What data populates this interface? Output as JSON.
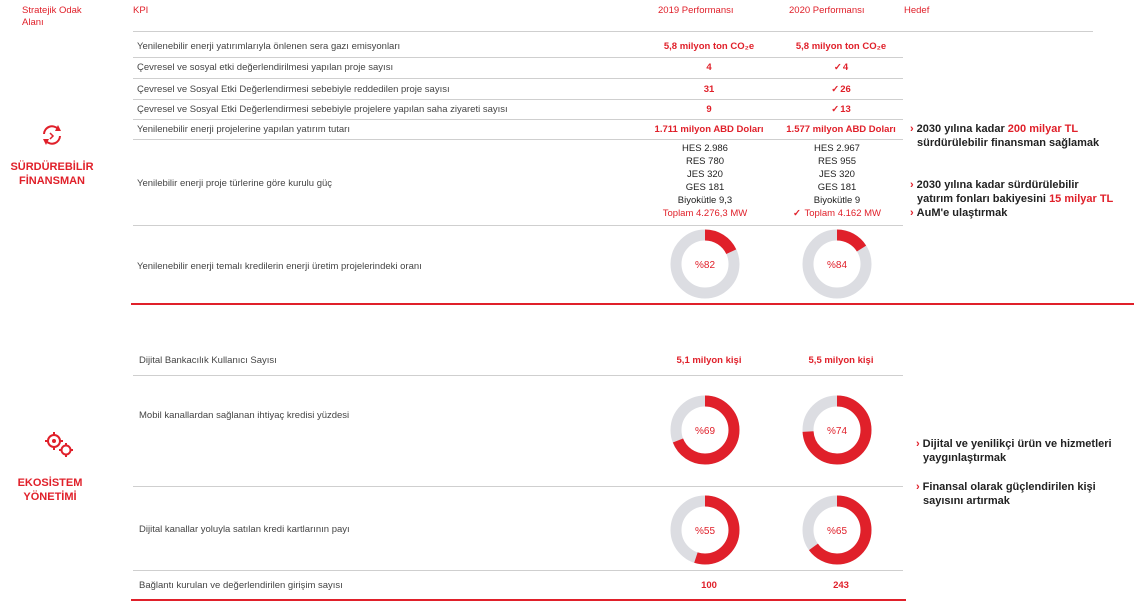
{
  "header": {
    "focus_area": "Stratejik Odak\nAlanı",
    "kpi": "KPI",
    "perf_2019": "2019 Performansı",
    "perf_2020": "2020 Performansı",
    "target": "Hedef"
  },
  "colors": {
    "accent": "#e0202a",
    "track": "#dcdde2"
  },
  "section1": {
    "title_line1": "SÜRDÜREBİLİR",
    "title_line2": "FİNANSMAN",
    "icon": "recycle-arrows-icon",
    "rows": [
      {
        "kpi": "Yenilenebilir enerji yatırımlarıyla önlenen sera gazı emisyonları",
        "v2019": "5,8 milyon ton CO₂e",
        "v2020": "5,8 milyon ton CO₂e"
      },
      {
        "kpi": "Çevresel ve sosyal etki değerlendirilmesi yapılan proje sayısı",
        "v2019": "4",
        "v2020": "4"
      },
      {
        "kpi": "Çevresel ve Sosyal Etki Değerlendirmesi sebebiyle reddedilen proje sayısı",
        "v2019": "31",
        "v2020": "26"
      },
      {
        "kpi": "Çevresel ve Sosyal Etki Değerlendirmesi sebebiyle projelere yapılan saha ziyareti sayısı",
        "v2019": "9",
        "v2020": "13"
      },
      {
        "kpi": "Yenilenebilir enerji projelerine yapılan yatırım tutarı",
        "v2019": "1.711 milyon ABD Doları",
        "v2020": "1.577 milyon ABD Doları"
      }
    ],
    "capacity": {
      "kpi": "Yenilebilir enerji proje türlerine göre kurulu güç",
      "v2019": [
        "HES 2.986",
        "RES 780",
        "JES 320",
        "GES 181",
        "Biyokütle 9,3"
      ],
      "v2019_total": "Toplam 4.276,3 MW",
      "v2020": [
        "HES 2.967",
        "RES 955",
        "JES 320",
        "GES 181",
        "Biyokütle 9"
      ],
      "v2020_total": "Toplam  4.162 MW"
    },
    "ratio": {
      "kpi": "Yenilenebilir enerji temalı kredilerin enerji üretim projelerindeki oranı",
      "v2019": "%82",
      "p2019": 0.18,
      "v2020": "%84",
      "p2020": 0.16
    },
    "goals": {
      "g1_a": "2030 yılına kadar ",
      "g1_hl": "200 milyar TL",
      "g1_b": "sürdürülebilir finansman sağlamak",
      "g2_a": "2030 yılına kadar sürdürülebilir",
      "g2_b": "yatırım fonları bakiyesini ",
      "g2_hl": "15 milyar TL",
      "g3": "AuM'e ulaştırmak"
    }
  },
  "section2": {
    "title_line1": "EKOSİSTEM",
    "title_line2": "YÖNETİMİ",
    "icon": "gears-icon",
    "users": {
      "kpi": "Dijital Bankacılık Kullanıcı Sayısı",
      "v2019": "5,1  milyon kişi",
      "v2020": "5,5  milyon kişi"
    },
    "mobile": {
      "kpi": "Mobil kanallardan sağlanan ihtiyaç kredisi  yüzdesi",
      "v2019": "%69",
      "p2019": 0.69,
      "v2020": "%74",
      "p2020": 0.74
    },
    "cards": {
      "kpi": "Dijital kanallar yoluyla satılan kredi kartlarının payı",
      "v2019": "%55",
      "p2019": 0.55,
      "v2020": "%65",
      "p2020": 0.65
    },
    "startups": {
      "kpi": "Bağlantı kurulan ve değerlendirilen girişim sayısı",
      "v2019": "100",
      "v2020": "243"
    },
    "goals": {
      "g1_a": "Dijital ve yenilikçi ürün ve hizmetleri",
      "g1_b": "yaygınlaştırmak",
      "g2_a": "Finansal olarak güçlendirilen kişi",
      "g2_b": "sayısını artırmak"
    }
  }
}
